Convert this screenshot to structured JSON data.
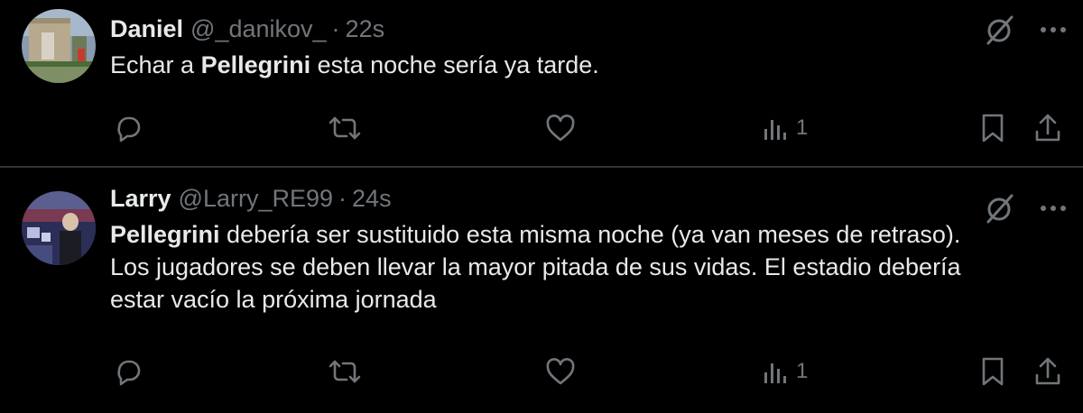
{
  "colors": {
    "background": "#000000",
    "divider": "#2f3336",
    "text_primary": "#e7e9ea",
    "text_secondary": "#71767b"
  },
  "tweets": [
    {
      "name": "Daniel",
      "handle": "@_danikov_",
      "separator": "·",
      "time": "22s",
      "text_parts": [
        {
          "text": "Echar a ",
          "bold": false
        },
        {
          "text": "Pellegrini",
          "bold": true
        },
        {
          "text": " esta noche sería ya tarde.",
          "bold": false
        }
      ],
      "views": "1",
      "icons": [
        "grok-icon",
        "more-icon",
        "reply-icon",
        "retweet-icon",
        "like-icon",
        "views-icon",
        "bookmark-icon",
        "share-icon"
      ]
    },
    {
      "name": "Larry",
      "handle": "@Larry_RE99",
      "separator": "·",
      "time": "24s",
      "text_parts": [
        {
          "text": "Pellegrini",
          "bold": true
        },
        {
          "text": " debería ser sustituido esta misma noche (ya van meses de retraso). Los jugadores se deben llevar la mayor pitada de sus vidas. El estadio debería estar vacío la próxima jornada",
          "bold": false
        }
      ],
      "views": "1",
      "icons": [
        "grok-icon",
        "more-icon",
        "reply-icon",
        "retweet-icon",
        "like-icon",
        "views-icon",
        "bookmark-icon",
        "share-icon"
      ]
    }
  ]
}
